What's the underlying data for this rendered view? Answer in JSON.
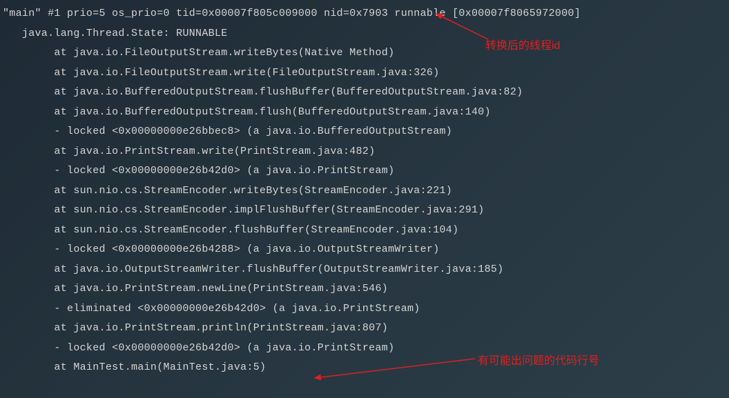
{
  "stacktrace": {
    "header": "\"main\" #1 prio=5 os_prio=0 tid=0x00007f805c009000 nid=0x7903 runnable [0x00007f8065972000]",
    "state": "   java.lang.Thread.State: RUNNABLE",
    "frames": [
      "        at java.io.FileOutputStream.writeBytes(Native Method)",
      "        at java.io.FileOutputStream.write(FileOutputStream.java:326)",
      "        at java.io.BufferedOutputStream.flushBuffer(BufferedOutputStream.java:82)",
      "        at java.io.BufferedOutputStream.flush(BufferedOutputStream.java:140)",
      "        - locked <0x00000000e26bbec8> (a java.io.BufferedOutputStream)",
      "        at java.io.PrintStream.write(PrintStream.java:482)",
      "        - locked <0x00000000e26b42d0> (a java.io.PrintStream)",
      "        at sun.nio.cs.StreamEncoder.writeBytes(StreamEncoder.java:221)",
      "        at sun.nio.cs.StreamEncoder.implFlushBuffer(StreamEncoder.java:291)",
      "        at sun.nio.cs.StreamEncoder.flushBuffer(StreamEncoder.java:104)",
      "        - locked <0x00000000e26b4288> (a java.io.OutputStreamWriter)",
      "        at java.io.OutputStreamWriter.flushBuffer(OutputStreamWriter.java:185)",
      "        at java.io.PrintStream.newLine(PrintStream.java:546)",
      "        - eliminated <0x00000000e26b42d0> (a java.io.PrintStream)",
      "        at java.io.PrintStream.println(PrintStream.java:807)",
      "        - locked <0x00000000e26b42d0> (a java.io.PrintStream)",
      "        at MainTest.main(MainTest.java:5)"
    ]
  },
  "annotations": {
    "thread_id": "转换后的线程id",
    "code_line": "有可能出问题的代码行号"
  }
}
